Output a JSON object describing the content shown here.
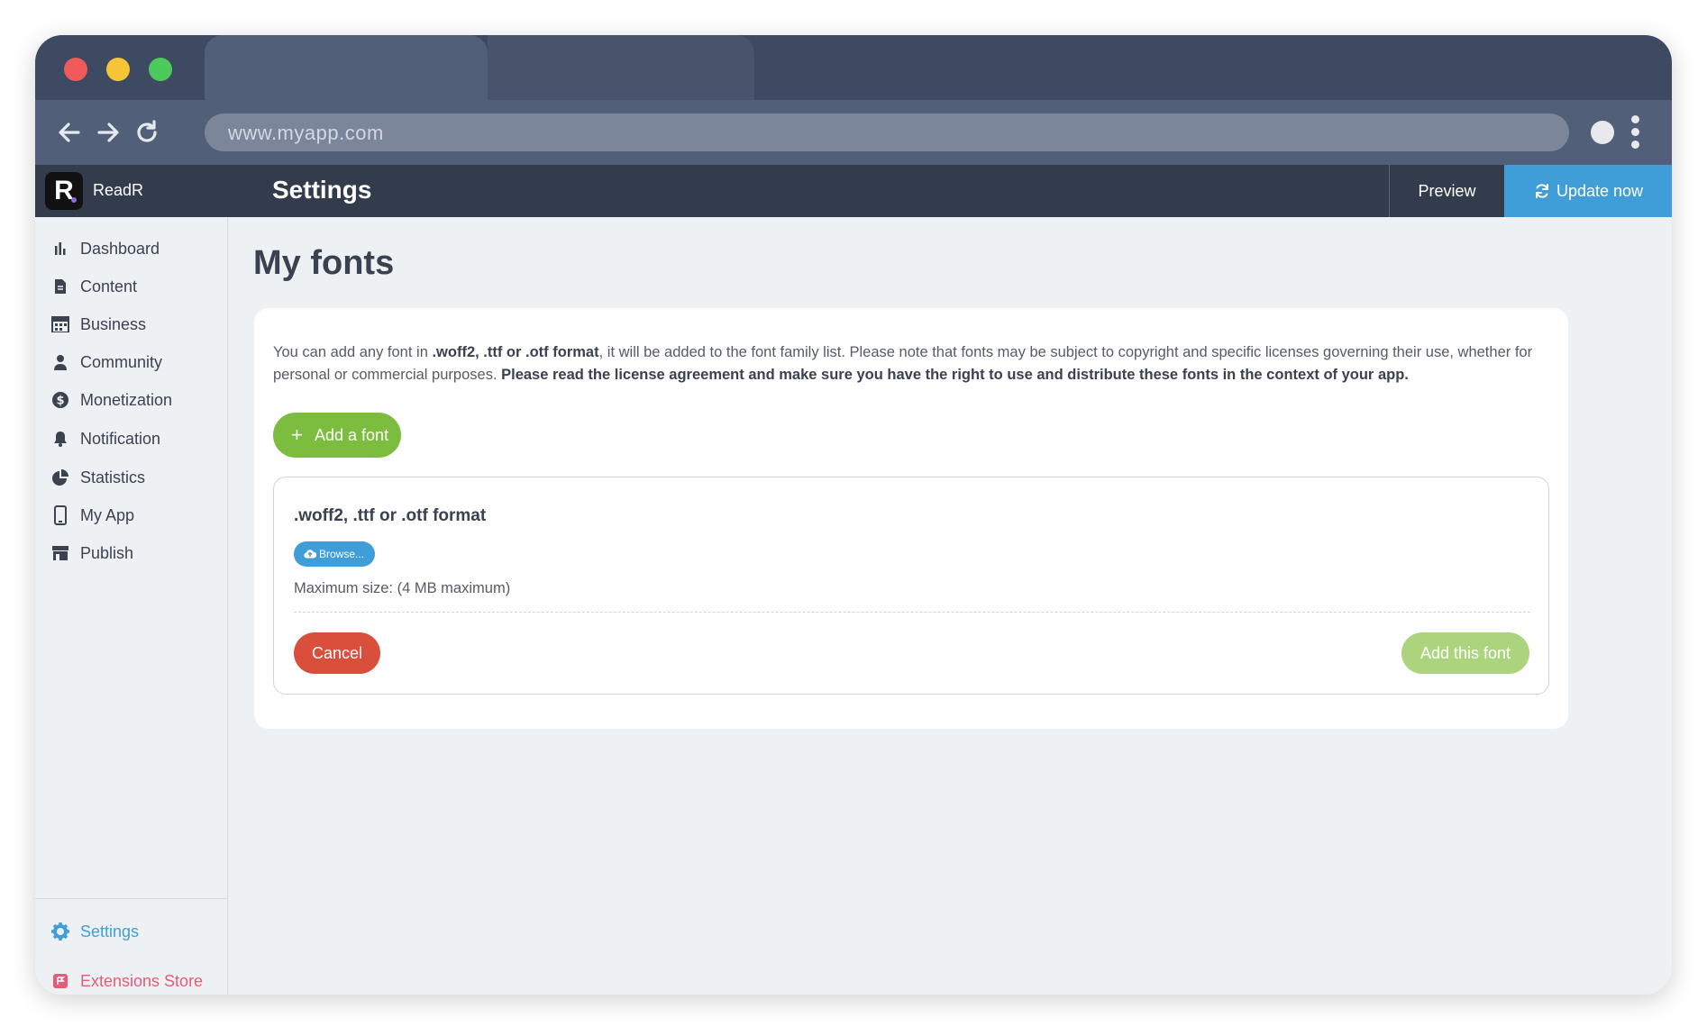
{
  "browser": {
    "url": "www.myapp.com"
  },
  "app": {
    "brand_letter": "R",
    "brand_name": "ReadR",
    "section_title": "Settings",
    "preview_label": "Preview",
    "update_label": "Update now"
  },
  "sidebar": {
    "items": [
      {
        "label": "Dashboard",
        "icon": "bar-chart-icon"
      },
      {
        "label": "Content",
        "icon": "document-icon"
      },
      {
        "label": "Business",
        "icon": "storefront-icon"
      },
      {
        "label": "Community",
        "icon": "user-icon"
      },
      {
        "label": "Monetization",
        "icon": "dollar-icon"
      },
      {
        "label": "Notification",
        "icon": "bell-icon"
      },
      {
        "label": "Statistics",
        "icon": "pie-chart-icon"
      },
      {
        "label": "My App",
        "icon": "phone-icon"
      },
      {
        "label": "Publish",
        "icon": "store-icon"
      }
    ],
    "footer": [
      {
        "label": "Settings",
        "icon": "gear-icon"
      },
      {
        "label": "Extensions Store",
        "icon": "extension-icon"
      }
    ]
  },
  "main": {
    "title": "My fonts",
    "desc_1": "You can add any font in ",
    "desc_bold_1": ".woff2, .ttf or .otf format",
    "desc_2": ", it will be added to the font family list. Please note that fonts may be subject to copyright and specific licenses governing their use, whether for personal or commercial purposes. ",
    "desc_bold_2": "Please read the license agreement and make sure you have the right to use and distribute these fonts in the context of your app.",
    "add_font_label": "Add a font",
    "upload": {
      "title": ".woff2, .ttf or .otf format",
      "browse_label": "Browse...",
      "max_size": "Maximum size: (4 MB maximum)",
      "cancel_label": "Cancel",
      "add_label": "Add this font"
    }
  },
  "colors": {
    "accent_blue": "#3f9ed8",
    "green": "#7cbd3f",
    "red": "#d94f3b",
    "header_dark": "#333c4d"
  }
}
